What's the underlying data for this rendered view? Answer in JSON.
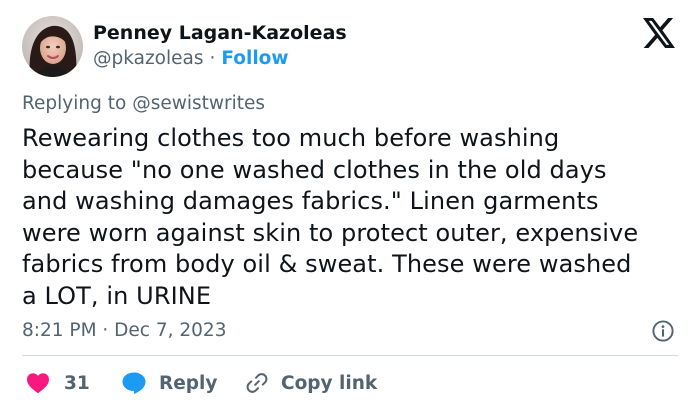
{
  "author": {
    "display_name": "Penney Lagan-Kazoleas",
    "handle": "@pkazoleas",
    "separator": "·",
    "follow_label": "Follow"
  },
  "reply_context": {
    "prefix": "Replying to",
    "mention": "@sewistwrites"
  },
  "tweet": {
    "lines": [
      "Rewearing clothes too much before washing",
      "because \"no one washed clothes in the old days",
      "and washing damages fabrics.\" Linen garments",
      "were worn against skin to protect outer, expensive",
      "fabrics from body oil & sweat. These were washed",
      "a LOT, in URINE"
    ],
    "timestamp": "8:21 PM · Dec 7, 2023"
  },
  "actions": {
    "like_count": "31",
    "reply_label": "Reply",
    "copy_link_label": "Copy link"
  },
  "icons": {
    "logo": "x-logo-icon",
    "info": "info-icon",
    "like": "heart-icon",
    "reply": "speech-bubble-icon",
    "copy_link": "link-icon"
  },
  "colors": {
    "text": "#0f1419",
    "secondary_text": "#536471",
    "link_blue": "#1d9bf0",
    "like_red": "#f91880",
    "reply_blue": "#1d9bf0",
    "divider": "#cfd9de"
  }
}
